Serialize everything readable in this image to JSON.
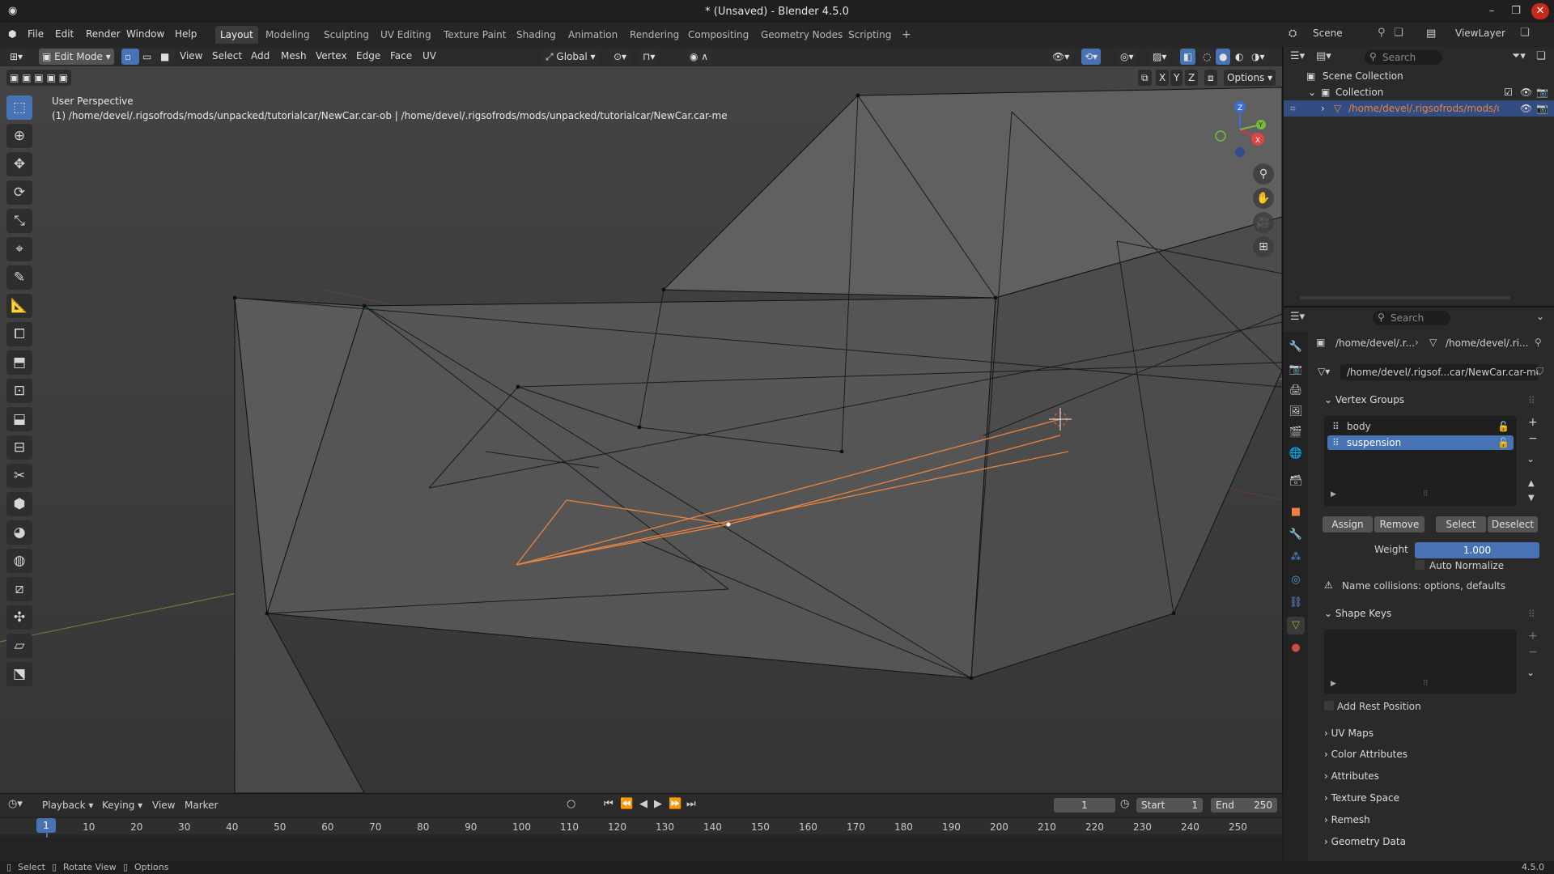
{
  "window": {
    "title": "* (Unsaved) - Blender 4.5.0",
    "controls": [
      "–",
      "❐",
      "✕"
    ]
  },
  "menus": [
    "File",
    "Edit",
    "Render",
    "Window",
    "Help"
  ],
  "workspaces": [
    {
      "label": "Layout",
      "active": true
    },
    {
      "label": "Modeling",
      "active": false
    },
    {
      "label": "Sculpting",
      "active": false
    },
    {
      "label": "UV Editing",
      "active": false
    },
    {
      "label": "Texture Paint",
      "active": false
    },
    {
      "label": "Shading",
      "active": false
    },
    {
      "label": "Animation",
      "active": false
    },
    {
      "label": "Rendering",
      "active": false
    },
    {
      "label": "Compositing",
      "active": false
    },
    {
      "label": "Geometry Nodes",
      "active": false
    },
    {
      "label": "Scripting",
      "active": false
    }
  ],
  "add_workspace": "+",
  "scene": {
    "label": "Scene",
    "viewlayer": "ViewLayer"
  },
  "viewport": {
    "mode": "Edit Mode",
    "menus": [
      "View",
      "Select",
      "Add",
      "Mesh",
      "Vertex",
      "Edge",
      "Face",
      "UV"
    ],
    "transform_orientation": "Global",
    "options_label": "Options",
    "axis_toggles": [
      "X",
      "Y",
      "Z"
    ],
    "overlay_title": "User Perspective",
    "overlay_object": "(1) /home/devel/.rigsofrods/mods/unpacked/tutorialcar/NewCar.car-ob | /home/devel/.rigsofrods/mods/unpacked/tutorialcar/NewCar.car-me",
    "gizmo_axes": {
      "x": "X",
      "y": "Y",
      "z": "Z"
    }
  },
  "outliner": {
    "search_placeholder": "Search",
    "scene_collection": "Scene Collection",
    "collection": "Collection",
    "object_path": "/home/devel/.rigsofrods/mods/ur"
  },
  "properties": {
    "search_placeholder": "Search",
    "breadcrumb_1": "/home/devel/.r...",
    "breadcrumb_2": "/home/devel/.ri...",
    "mesh_name": "/home/devel/.rigsof...car/NewCar.car-me",
    "vertex_groups_title": "Vertex Groups",
    "vertex_groups": [
      {
        "name": "body",
        "selected": false
      },
      {
        "name": "suspension",
        "selected": true
      }
    ],
    "assign": "Assign",
    "remove": "Remove",
    "select": "Select",
    "deselect": "Deselect",
    "weight_label": "Weight",
    "weight_value": "1.000",
    "auto_normalize": "Auto Normalize",
    "warning": "Name collisions: options, defaults",
    "shape_keys_title": "Shape Keys",
    "add_rest_position": "Add Rest Position",
    "collapsed_panels": [
      "UV Maps",
      "Color Attributes",
      "Attributes",
      "Texture Space",
      "Remesh",
      "Geometry Data"
    ]
  },
  "timeline": {
    "menus": [
      "Playback",
      "Keying",
      "View",
      "Marker"
    ],
    "current_frame": "1",
    "start_label": "Start",
    "start_value": "1",
    "end_label": "End",
    "end_value": "250",
    "ticks": [
      "1",
      "10",
      "20",
      "30",
      "40",
      "50",
      "60",
      "70",
      "80",
      "90",
      "100",
      "110",
      "120",
      "130",
      "140",
      "150",
      "160",
      "170",
      "180",
      "190",
      "200",
      "210",
      "220",
      "230",
      "240",
      "250"
    ]
  },
  "statusbar": {
    "select": "Select",
    "rotate_view": "Rotate View",
    "options": "Options",
    "version": "4.5.0"
  },
  "colors": {
    "accent": "#4772b3",
    "selection_orange": "#e9833f",
    "active_tab": "#3c3c3c"
  }
}
